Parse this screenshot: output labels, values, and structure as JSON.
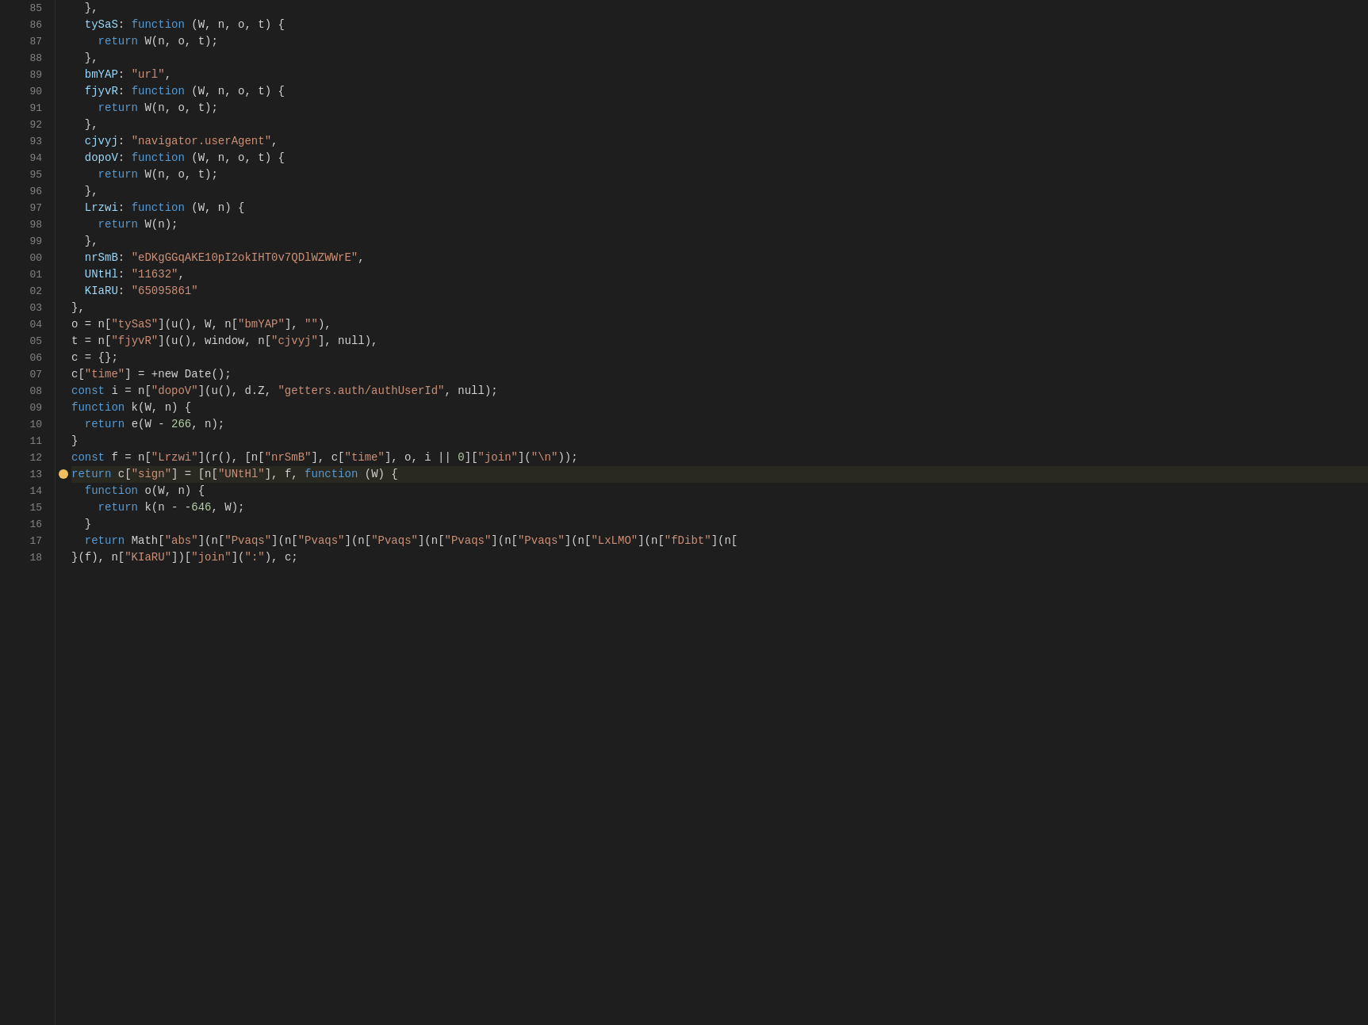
{
  "editor": {
    "background": "#1e1e1e",
    "lines": [
      {
        "num": "85",
        "tokens": [
          {
            "t": "  },",
            "c": "punct"
          }
        ]
      },
      {
        "num": "86",
        "tokens": [
          {
            "t": "  tySaS",
            "c": "obj-key"
          },
          {
            "t": ": ",
            "c": "punct"
          },
          {
            "t": "function",
            "c": "kw"
          },
          {
            "t": " (W, n, o, t) {",
            "c": "plain"
          }
        ]
      },
      {
        "num": "87",
        "tokens": [
          {
            "t": "    ",
            "c": "plain"
          },
          {
            "t": "return",
            "c": "kw"
          },
          {
            "t": " W(n, o, t);",
            "c": "plain"
          }
        ]
      },
      {
        "num": "88",
        "tokens": [
          {
            "t": "  },",
            "c": "punct"
          }
        ]
      },
      {
        "num": "89",
        "tokens": [
          {
            "t": "  bmYAP",
            "c": "obj-key"
          },
          {
            "t": ": ",
            "c": "punct"
          },
          {
            "t": "\"url\"",
            "c": "str"
          },
          {
            "t": ",",
            "c": "punct"
          }
        ]
      },
      {
        "num": "90",
        "tokens": [
          {
            "t": "  fjyvR",
            "c": "obj-key"
          },
          {
            "t": ": ",
            "c": "punct"
          },
          {
            "t": "function",
            "c": "kw"
          },
          {
            "t": " (W, n, o, t) {",
            "c": "plain"
          }
        ]
      },
      {
        "num": "91",
        "tokens": [
          {
            "t": "    ",
            "c": "plain"
          },
          {
            "t": "return",
            "c": "kw"
          },
          {
            "t": " W(n, o, t);",
            "c": "plain"
          }
        ]
      },
      {
        "num": "92",
        "tokens": [
          {
            "t": "  },",
            "c": "punct"
          }
        ]
      },
      {
        "num": "93",
        "tokens": [
          {
            "t": "  cjvyj",
            "c": "obj-key"
          },
          {
            "t": ": ",
            "c": "punct"
          },
          {
            "t": "\"navigator.userAgent\"",
            "c": "str"
          },
          {
            "t": ",",
            "c": "punct"
          }
        ]
      },
      {
        "num": "94",
        "tokens": [
          {
            "t": "  dopoV",
            "c": "obj-key"
          },
          {
            "t": ": ",
            "c": "punct"
          },
          {
            "t": "function",
            "c": "kw"
          },
          {
            "t": " (W, n, o, t) {",
            "c": "plain"
          }
        ]
      },
      {
        "num": "95",
        "tokens": [
          {
            "t": "    ",
            "c": "plain"
          },
          {
            "t": "return",
            "c": "kw"
          },
          {
            "t": " W(n, o, t);",
            "c": "plain"
          }
        ]
      },
      {
        "num": "96",
        "tokens": [
          {
            "t": "  },",
            "c": "punct"
          }
        ]
      },
      {
        "num": "97",
        "tokens": [
          {
            "t": "  Lrzwi",
            "c": "obj-key"
          },
          {
            "t": ": ",
            "c": "punct"
          },
          {
            "t": "function",
            "c": "kw"
          },
          {
            "t": " (W, n) {",
            "c": "plain"
          }
        ]
      },
      {
        "num": "98",
        "tokens": [
          {
            "t": "    ",
            "c": "plain"
          },
          {
            "t": "return",
            "c": "kw"
          },
          {
            "t": " W(n);",
            "c": "plain"
          }
        ]
      },
      {
        "num": "99",
        "tokens": [
          {
            "t": "  },",
            "c": "punct"
          }
        ]
      },
      {
        "num": "00",
        "tokens": [
          {
            "t": "  nrSmB",
            "c": "obj-key"
          },
          {
            "t": ": ",
            "c": "punct"
          },
          {
            "t": "\"eDKgGGqAKE10pI2okIHT0v7QDlWZWWrE\"",
            "c": "str"
          },
          {
            "t": ",",
            "c": "punct"
          }
        ]
      },
      {
        "num": "01",
        "tokens": [
          {
            "t": "  UNtHl",
            "c": "obj-key"
          },
          {
            "t": ": ",
            "c": "punct"
          },
          {
            "t": "\"11632\"",
            "c": "str"
          },
          {
            "t": ",",
            "c": "punct"
          }
        ]
      },
      {
        "num": "02",
        "tokens": [
          {
            "t": "  KIaRU",
            "c": "obj-key"
          },
          {
            "t": ": ",
            "c": "punct"
          },
          {
            "t": "\"65095861\"",
            "c": "str"
          }
        ]
      },
      {
        "num": "03",
        "tokens": [
          {
            "t": "},",
            "c": "punct"
          }
        ]
      },
      {
        "num": "04",
        "tokens": [
          {
            "t": "o = n[",
            "c": "plain"
          },
          {
            "t": "\"tySaS\"",
            "c": "str"
          },
          {
            "t": "](u(), W, n[",
            "c": "plain"
          },
          {
            "t": "\"bmYAP\"",
            "c": "str"
          },
          {
            "t": "], ",
            "c": "plain"
          },
          {
            "t": "\"\"",
            "c": "str"
          },
          {
            "t": "),",
            "c": "plain"
          }
        ]
      },
      {
        "num": "05",
        "tokens": [
          {
            "t": "t = n[",
            "c": "plain"
          },
          {
            "t": "\"fjyvR\"",
            "c": "str"
          },
          {
            "t": "](u(), window, n[",
            "c": "plain"
          },
          {
            "t": "\"cjvyj\"",
            "c": "str"
          },
          {
            "t": "], null),",
            "c": "plain"
          }
        ]
      },
      {
        "num": "06",
        "tokens": [
          {
            "t": "c = {};",
            "c": "plain"
          }
        ]
      },
      {
        "num": "07",
        "tokens": [
          {
            "t": "c[",
            "c": "plain"
          },
          {
            "t": "\"time\"",
            "c": "str"
          },
          {
            "t": "] = +new Date();",
            "c": "plain"
          }
        ]
      },
      {
        "num": "08",
        "tokens": [
          {
            "t": "const",
            "c": "kw"
          },
          {
            "t": " i = n[",
            "c": "plain"
          },
          {
            "t": "\"dopoV\"",
            "c": "str"
          },
          {
            "t": "](u(), d.Z, ",
            "c": "plain"
          },
          {
            "t": "\"getters.auth/authUserId\"",
            "c": "str"
          },
          {
            "t": ", null);",
            "c": "plain"
          }
        ]
      },
      {
        "num": "09",
        "tokens": [
          {
            "t": "function",
            "c": "kw"
          },
          {
            "t": " k(W, n) {",
            "c": "plain"
          }
        ]
      },
      {
        "num": "10",
        "tokens": [
          {
            "t": "  ",
            "c": "plain"
          },
          {
            "t": "return",
            "c": "kw"
          },
          {
            "t": " e(W - ",
            "c": "plain"
          },
          {
            "t": "266",
            "c": "num"
          },
          {
            "t": ", n);",
            "c": "plain"
          }
        ]
      },
      {
        "num": "11",
        "tokens": [
          {
            "t": "}",
            "c": "punct"
          }
        ]
      },
      {
        "num": "12",
        "tokens": [
          {
            "t": "const",
            "c": "kw"
          },
          {
            "t": " f = n[",
            "c": "plain"
          },
          {
            "t": "\"Lrzwi\"",
            "c": "str"
          },
          {
            "t": "](r(), [n[",
            "c": "plain"
          },
          {
            "t": "\"nrSmB\"",
            "c": "str"
          },
          {
            "t": "], c[",
            "c": "plain"
          },
          {
            "t": "\"time\"",
            "c": "str"
          },
          {
            "t": "], o, i || ",
            "c": "plain"
          },
          {
            "t": "0",
            "c": "num"
          },
          {
            "t": "][",
            "c": "plain"
          },
          {
            "t": "\"join\"",
            "c": "str"
          },
          {
            "t": "](",
            "c": "plain"
          },
          {
            "t": "\"\\n\"",
            "c": "str"
          },
          {
            "t": "));",
            "c": "plain"
          }
        ]
      },
      {
        "num": "13",
        "tokens": [
          {
            "t": "return",
            "c": "kw"
          },
          {
            "t": " c[",
            "c": "plain"
          },
          {
            "t": "\"sign\"",
            "c": "str"
          },
          {
            "t": "] = [n[",
            "c": "plain"
          },
          {
            "t": "\"UNtHl\"",
            "c": "str"
          },
          {
            "t": "], f, ",
            "c": "plain"
          },
          {
            "t": "function",
            "c": "kw"
          },
          {
            "t": " (W) {",
            "c": "plain"
          }
        ],
        "hasBreakpoint": true
      },
      {
        "num": "14",
        "tokens": [
          {
            "t": "  ",
            "c": "plain"
          },
          {
            "t": "function",
            "c": "kw"
          },
          {
            "t": " o(W, n) {",
            "c": "plain"
          }
        ]
      },
      {
        "num": "15",
        "tokens": [
          {
            "t": "    ",
            "c": "plain"
          },
          {
            "t": "return",
            "c": "kw"
          },
          {
            "t": " k(n - -",
            "c": "plain"
          },
          {
            "t": "646",
            "c": "num"
          },
          {
            "t": ", W);",
            "c": "plain"
          }
        ]
      },
      {
        "num": "16",
        "tokens": [
          {
            "t": "  }",
            "c": "punct"
          }
        ]
      },
      {
        "num": "17",
        "tokens": [
          {
            "t": "  ",
            "c": "plain"
          },
          {
            "t": "return",
            "c": "kw"
          },
          {
            "t": " Math[",
            "c": "plain"
          },
          {
            "t": "\"abs\"",
            "c": "str"
          },
          {
            "t": "](n[",
            "c": "plain"
          },
          {
            "t": "\"Pvaqs\"",
            "c": "str"
          },
          {
            "t": "](n[",
            "c": "plain"
          },
          {
            "t": "\"Pvaqs\"",
            "c": "str"
          },
          {
            "t": "](n[",
            "c": "plain"
          },
          {
            "t": "\"Pvaqs\"",
            "c": "str"
          },
          {
            "t": "](n[",
            "c": "plain"
          },
          {
            "t": "\"Pvaqs\"",
            "c": "str"
          },
          {
            "t": "](n[",
            "c": "plain"
          },
          {
            "t": "\"Pvaqs\"",
            "c": "str"
          },
          {
            "t": "](n[",
            "c": "plain"
          },
          {
            "t": "\"LxLMO\"",
            "c": "str"
          },
          {
            "t": "](n[",
            "c": "plain"
          },
          {
            "t": "\"fDibt\"",
            "c": "str"
          },
          {
            "t": "](n[",
            "c": "plain"
          }
        ]
      },
      {
        "num": "18",
        "tokens": [
          {
            "t": "}(f), n[",
            "c": "plain"
          },
          {
            "t": "\"KIaRU\"",
            "c": "str"
          },
          {
            "t": "])[",
            "c": "plain"
          },
          {
            "t": "\"join\"",
            "c": "str"
          },
          {
            "t": "](",
            "c": "plain"
          },
          {
            "t": "\":\"",
            "c": "str"
          },
          {
            "t": "), c;",
            "c": "plain"
          }
        ]
      }
    ]
  }
}
